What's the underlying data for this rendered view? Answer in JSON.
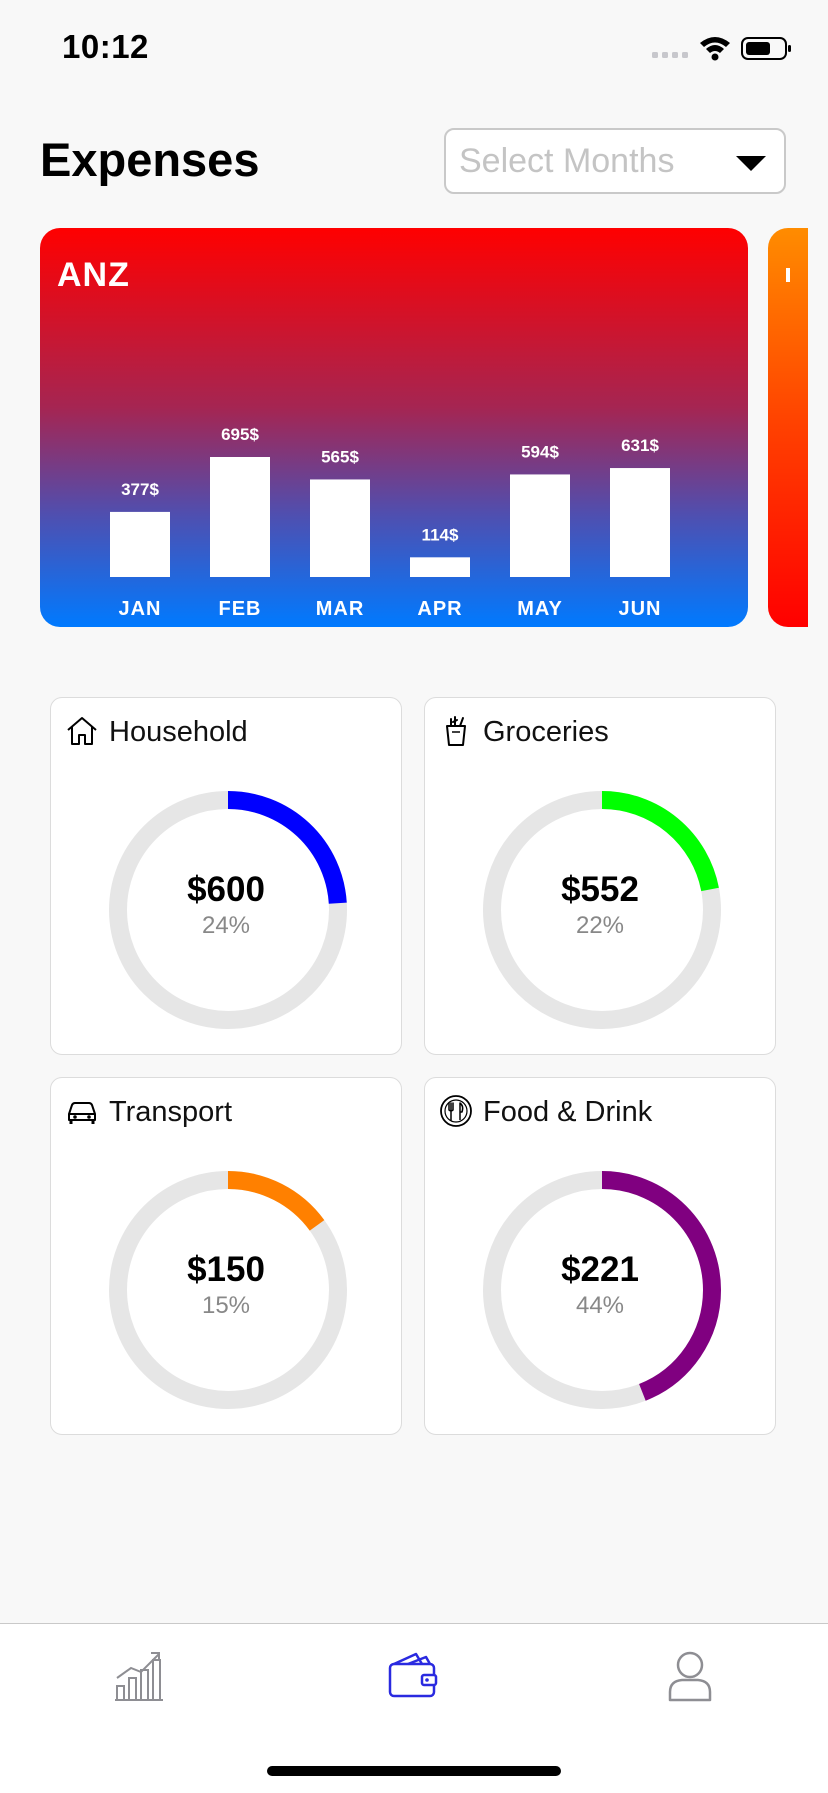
{
  "status_bar": {
    "time": "10:12"
  },
  "header": {
    "title": "Expenses",
    "select_placeholder": "Select Months"
  },
  "bank_card": {
    "name": "ANZ",
    "colors": {
      "top": "#ff0000",
      "bottom": "#007aff"
    }
  },
  "chart_data": {
    "type": "bar",
    "title": "ANZ",
    "categories": [
      "JAN",
      "FEB",
      "MAR",
      "APR",
      "MAY",
      "JUN"
    ],
    "values": [
      377,
      695,
      565,
      114,
      594,
      631
    ],
    "value_labels": [
      "377$",
      "695$",
      "565$",
      "114$",
      "594$",
      "631$"
    ],
    "xlabel": "",
    "ylabel": "",
    "grid": false,
    "bar_color": "#ffffff"
  },
  "categories": [
    {
      "name": "Household",
      "amount": "$600",
      "percent_label": "24%",
      "percent": 24,
      "color": "#0000ff",
      "icon": "house-icon"
    },
    {
      "name": "Groceries",
      "amount": "$552",
      "percent_label": "22%",
      "percent": 22,
      "color": "#00ff00",
      "icon": "grocery-bag-icon"
    },
    {
      "name": "Transport",
      "amount": "$150",
      "percent_label": "15%",
      "percent": 15,
      "color": "#ff8000",
      "icon": "car-icon"
    },
    {
      "name": "Food & Drink",
      "amount": "$221",
      "percent_label": "44%",
      "percent": 44,
      "color": "#800080",
      "icon": "fork-knife-icon"
    }
  ],
  "tab_bar": {
    "active_color": "#2a2ae0",
    "inactive_color": "#8e8e93",
    "tabs": [
      {
        "icon": "growth-chart-icon",
        "active": false
      },
      {
        "icon": "wallet-icon",
        "active": true
      },
      {
        "icon": "profile-icon",
        "active": false
      }
    ]
  }
}
